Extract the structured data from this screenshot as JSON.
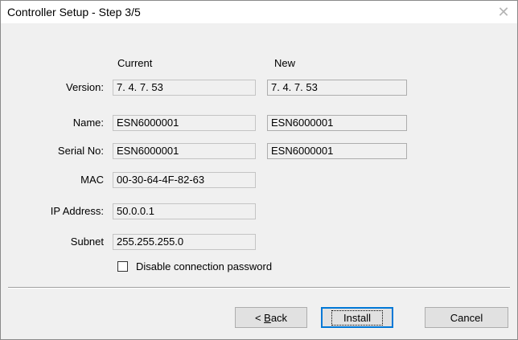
{
  "window": {
    "title": "Controller Setup - Step 3/5",
    "close_glyph": "✕"
  },
  "columns": {
    "current": "Current",
    "new": "New"
  },
  "rows": [
    {
      "label": "Version:",
      "current": "7. 4. 7. 53",
      "new": "7. 4. 7. 53"
    },
    {
      "label": "Name:",
      "current": "ESN6000001",
      "new": "ESN6000001"
    },
    {
      "label": "Serial No:",
      "current": "ESN6000001",
      "new": "ESN6000001"
    },
    {
      "label": "MAC",
      "current": "00-30-64-4F-82-63"
    },
    {
      "label": "IP Address:",
      "current": "50.0.0.1"
    },
    {
      "label": "Subnet",
      "current": "255.255.255.0"
    }
  ],
  "options": {
    "disable_password_label": "Disable connection password",
    "disable_password_checked": false
  },
  "buttons": {
    "back_prefix": "< ",
    "back_mnemonic": "B",
    "back_rest": "ack",
    "install": "Install",
    "cancel": "Cancel"
  }
}
